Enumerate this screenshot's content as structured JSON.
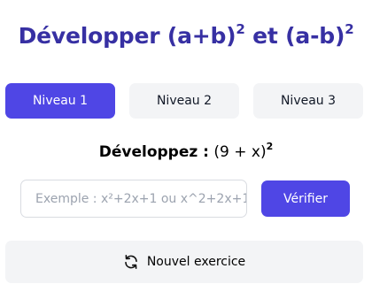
{
  "header": {
    "title_text": "Développer (a+b)",
    "title_sup1": "2",
    "title_mid": " et (a-b)",
    "title_sup2": "2"
  },
  "levels": [
    {
      "label": "Niveau 1",
      "active": true
    },
    {
      "label": "Niveau 2",
      "active": false
    },
    {
      "label": "Niveau 3",
      "active": false
    }
  ],
  "exercise": {
    "prompt_label": "Développez :",
    "expression": " (9 + x)",
    "exponent": "2"
  },
  "answer": {
    "value": "",
    "placeholder": "Exemple : x²+2x+1 ou x^2+2x+1"
  },
  "verify_label": "Vérifier",
  "new_exercise": {
    "label": "Nouvel exercice",
    "icon": "refresh-icon"
  },
  "colors": {
    "accent": "#4f46e5",
    "title": "#3730a3",
    "button_bg": "#f3f4f6"
  }
}
